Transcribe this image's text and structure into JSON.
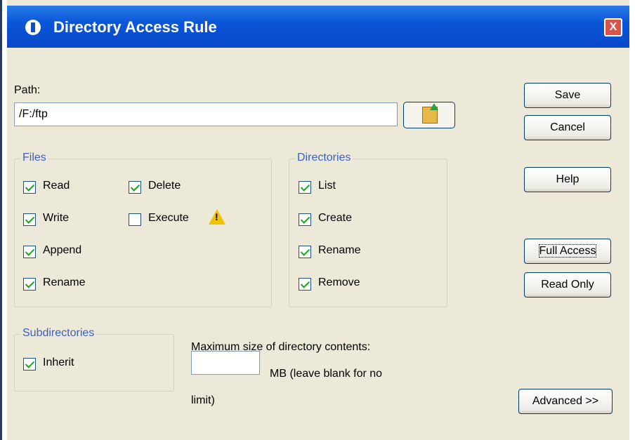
{
  "window": {
    "title": "Directory Access Rule",
    "close_label": "X"
  },
  "path": {
    "label": "Path:",
    "value": "/F:/ftp"
  },
  "files": {
    "legend": "Files",
    "read": "Read",
    "write": "Write",
    "append": "Append",
    "rename": "Rename",
    "delete": "Delete",
    "execute": "Execute"
  },
  "directories": {
    "legend": "Directories",
    "list": "List",
    "create": "Create",
    "rename": "Rename",
    "remove": "Remove"
  },
  "subdirectories": {
    "legend": "Subdirectories",
    "inherit": "Inherit"
  },
  "size": {
    "label": "Maximum size of directory contents:",
    "unit_text": "MB (leave blank for no",
    "unit_text_cont": "limit)",
    "value": ""
  },
  "buttons": {
    "save": "Save",
    "cancel": "Cancel",
    "help": "Help",
    "full_access": "Full Access",
    "read_only": "Read Only",
    "advanced": "Advanced >>"
  },
  "checked": {
    "files_read": true,
    "files_write": true,
    "files_append": true,
    "files_rename": true,
    "files_delete": true,
    "files_execute": false,
    "dir_list": true,
    "dir_create": true,
    "dir_rename": true,
    "dir_remove": true,
    "subdir_inherit": true
  },
  "icons": {
    "app": "info-icon",
    "folder": "folder-up-icon",
    "warning": "warning-icon"
  },
  "colors": {
    "titlebar": "#0a56d8",
    "legend_text": "#3b5ec2",
    "dialog_bg": "#ECE9D8",
    "check": "#21a121"
  }
}
